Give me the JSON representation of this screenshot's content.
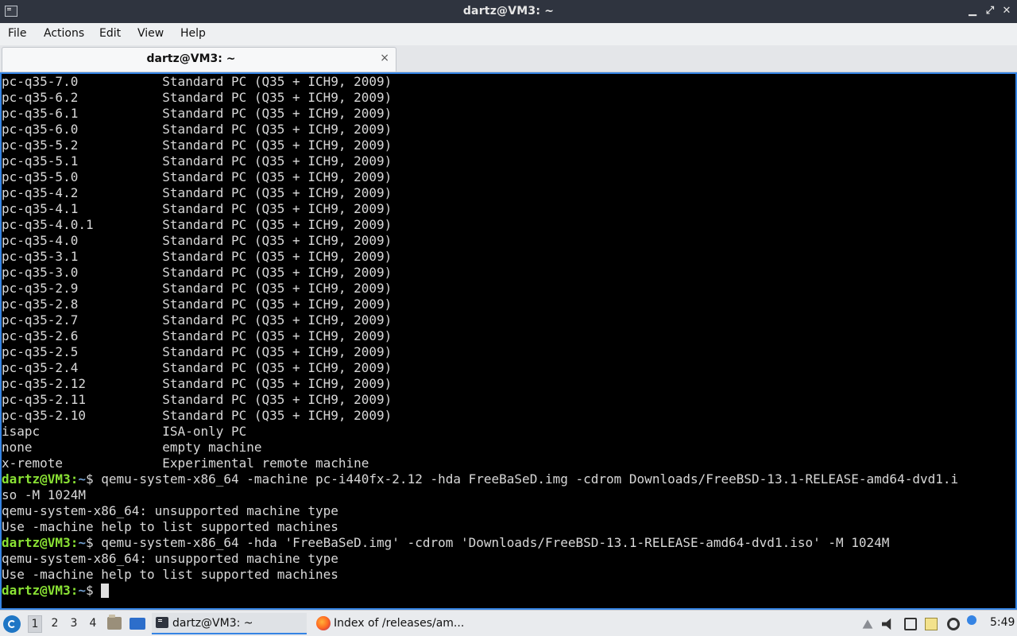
{
  "window": {
    "title": "dartz@VM3: ~",
    "controls": {
      "minimize": "▁",
      "maximize": "⤢",
      "close": "✕"
    }
  },
  "menu": [
    "File",
    "Actions",
    "Edit",
    "View",
    "Help"
  ],
  "tab": {
    "label": "dartz@VM3: ~",
    "close": "×"
  },
  "terminal": {
    "prompt_user": "dartz@VM3",
    "prompt_path": "~",
    "lines": [
      "pc-q35-7.0           Standard PC (Q35 + ICH9, 2009)",
      "pc-q35-6.2           Standard PC (Q35 + ICH9, 2009)",
      "pc-q35-6.1           Standard PC (Q35 + ICH9, 2009)",
      "pc-q35-6.0           Standard PC (Q35 + ICH9, 2009)",
      "pc-q35-5.2           Standard PC (Q35 + ICH9, 2009)",
      "pc-q35-5.1           Standard PC (Q35 + ICH9, 2009)",
      "pc-q35-5.0           Standard PC (Q35 + ICH9, 2009)",
      "pc-q35-4.2           Standard PC (Q35 + ICH9, 2009)",
      "pc-q35-4.1           Standard PC (Q35 + ICH9, 2009)",
      "pc-q35-4.0.1         Standard PC (Q35 + ICH9, 2009)",
      "pc-q35-4.0           Standard PC (Q35 + ICH9, 2009)",
      "pc-q35-3.1           Standard PC (Q35 + ICH9, 2009)",
      "pc-q35-3.0           Standard PC (Q35 + ICH9, 2009)",
      "pc-q35-2.9           Standard PC (Q35 + ICH9, 2009)",
      "pc-q35-2.8           Standard PC (Q35 + ICH9, 2009)",
      "pc-q35-2.7           Standard PC (Q35 + ICH9, 2009)",
      "pc-q35-2.6           Standard PC (Q35 + ICH9, 2009)",
      "pc-q35-2.5           Standard PC (Q35 + ICH9, 2009)",
      "pc-q35-2.4           Standard PC (Q35 + ICH9, 2009)",
      "pc-q35-2.12          Standard PC (Q35 + ICH9, 2009)",
      "pc-q35-2.11          Standard PC (Q35 + ICH9, 2009)",
      "pc-q35-2.10          Standard PC (Q35 + ICH9, 2009)",
      "isapc                ISA-only PC",
      "none                 empty machine",
      "x-remote             Experimental remote machine"
    ],
    "cmd1": "$ qemu-system-x86_64 -machine pc-i440fx-2.12 -hda FreeBaSeD.img -cdrom Downloads/FreeBSD-13.1-RELEASE-amd64-dvd1.i",
    "cmd1_wrap": "so -M 1024M",
    "err1": "qemu-system-x86_64: unsupported machine type",
    "hint1": "Use -machine help to list supported machines",
    "cmd2": "$ qemu-system-x86_64 -hda 'FreeBaSeD.img' -cdrom 'Downloads/FreeBSD-13.1-RELEASE-amd64-dvd1.iso' -M 1024M",
    "err2": "qemu-system-x86_64: unsupported machine type",
    "hint2": "Use -machine help to list supported machines",
    "cmd3": "$ "
  },
  "taskbar": {
    "workspaces": [
      "1",
      "2",
      "3",
      "4"
    ],
    "tasks": [
      {
        "label": "dartz@VM3: ~",
        "icon": "terminal-icon"
      },
      {
        "label": "Index of /releases/am...",
        "icon": "firefox-icon"
      }
    ],
    "clock": "5:49"
  }
}
